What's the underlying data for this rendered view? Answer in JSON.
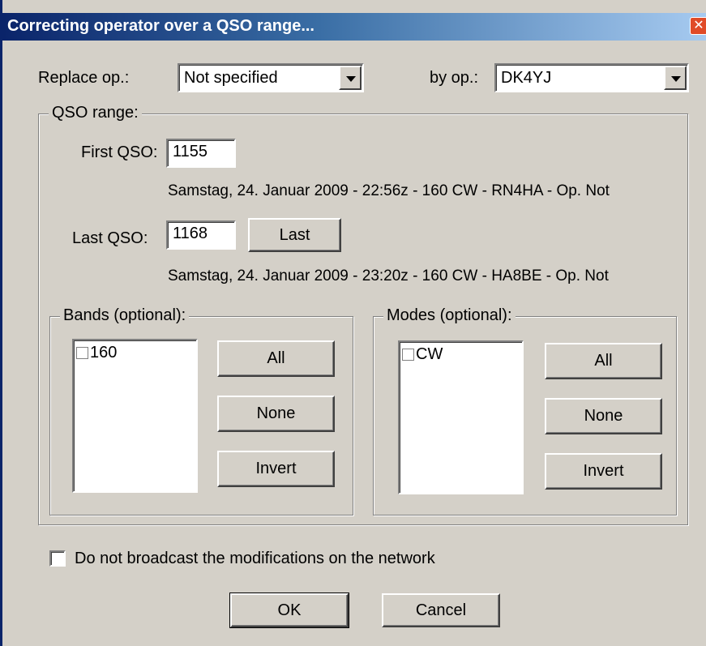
{
  "window": {
    "title": "Correcting operator over a QSO range...",
    "close_glyph": "✕"
  },
  "replace_op": {
    "label": "Replace op.:",
    "value": "Not specified"
  },
  "by_op": {
    "label": "by op.:",
    "value": "DK4YJ"
  },
  "qso_range": {
    "label": "QSO range:",
    "first_label": "First QSO:",
    "first_value": "1155",
    "first_info": "Samstag, 24. Januar 2009 - 22:56z - 160 CW - RN4HA - Op. Not",
    "last_label": "Last QSO:",
    "last_value": "1168",
    "last_button": "Last",
    "last_info": "Samstag, 24. Januar 2009 - 23:20z - 160 CW - HA8BE - Op. Not"
  },
  "bands": {
    "label": "Bands (optional):",
    "items": [
      "160"
    ],
    "all_label": "All",
    "none_label": "None",
    "invert_label": "Invert"
  },
  "modes": {
    "label": "Modes (optional):",
    "items": [
      "CW"
    ],
    "all_label": "All",
    "none_label": "None",
    "invert_label": "Invert"
  },
  "no_broadcast": {
    "label": "Do not broadcast the modifications on the network",
    "checked": false
  },
  "buttons": {
    "ok": "OK",
    "cancel": "Cancel"
  },
  "colors": {
    "title_start": "#0a246a",
    "title_end": "#a6caf0",
    "face": "#d4d0c8"
  }
}
